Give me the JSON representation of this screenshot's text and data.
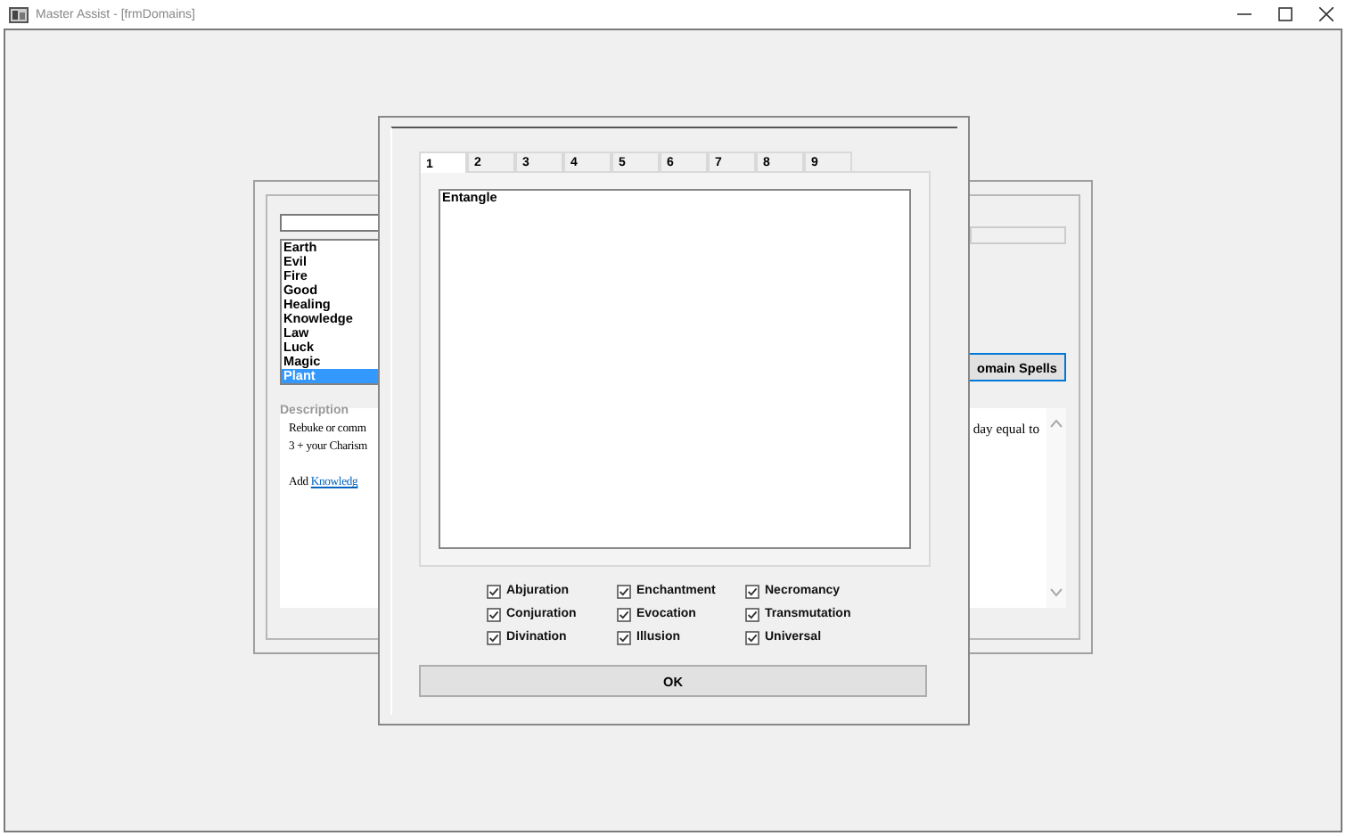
{
  "window": {
    "title": "Master Assist - [frmDomains]"
  },
  "domains_form": {
    "domains": [
      {
        "label": "Earth",
        "selected": false
      },
      {
        "label": "Evil",
        "selected": false
      },
      {
        "label": "Fire",
        "selected": false
      },
      {
        "label": "Good",
        "selected": false
      },
      {
        "label": "Healing",
        "selected": false
      },
      {
        "label": "Knowledge",
        "selected": false
      },
      {
        "label": "Law",
        "selected": false
      },
      {
        "label": "Luck",
        "selected": false
      },
      {
        "label": "Magic",
        "selected": false
      },
      {
        "label": "Plant",
        "selected": true
      }
    ],
    "description_label": "Description",
    "description_lines": [
      "Rebuke or comm",
      "3 + your Charism"
    ],
    "link_prefix": "Add",
    "link": "Knowledg",
    "description_right": "day equal to",
    "button": "omain Spells"
  },
  "dialog": {
    "tabs": [
      {
        "label": "1",
        "selected": true
      },
      {
        "label": "2",
        "selected": false
      },
      {
        "label": "3",
        "selected": false
      },
      {
        "label": "4",
        "selected": false
      },
      {
        "label": "5",
        "selected": false
      },
      {
        "label": "6",
        "selected": false
      },
      {
        "label": "7",
        "selected": false
      },
      {
        "label": "8",
        "selected": false
      },
      {
        "label": "9",
        "selected": false
      }
    ],
    "spells": [
      {
        "label": "Entangle",
        "selected": false
      }
    ],
    "schools": [
      {
        "label": "Abjuration",
        "checked": true
      },
      {
        "label": "Enchantment",
        "checked": true
      },
      {
        "label": "Necromancy",
        "checked": true
      },
      {
        "label": "Conjuration",
        "checked": true
      },
      {
        "label": "Evocation",
        "checked": true
      },
      {
        "label": "Transmutation",
        "checked": true
      },
      {
        "label": "Divination",
        "checked": true
      },
      {
        "label": "Illusion",
        "checked": true
      },
      {
        "label": "Universal",
        "checked": true
      }
    ],
    "ok_button": "OK"
  }
}
